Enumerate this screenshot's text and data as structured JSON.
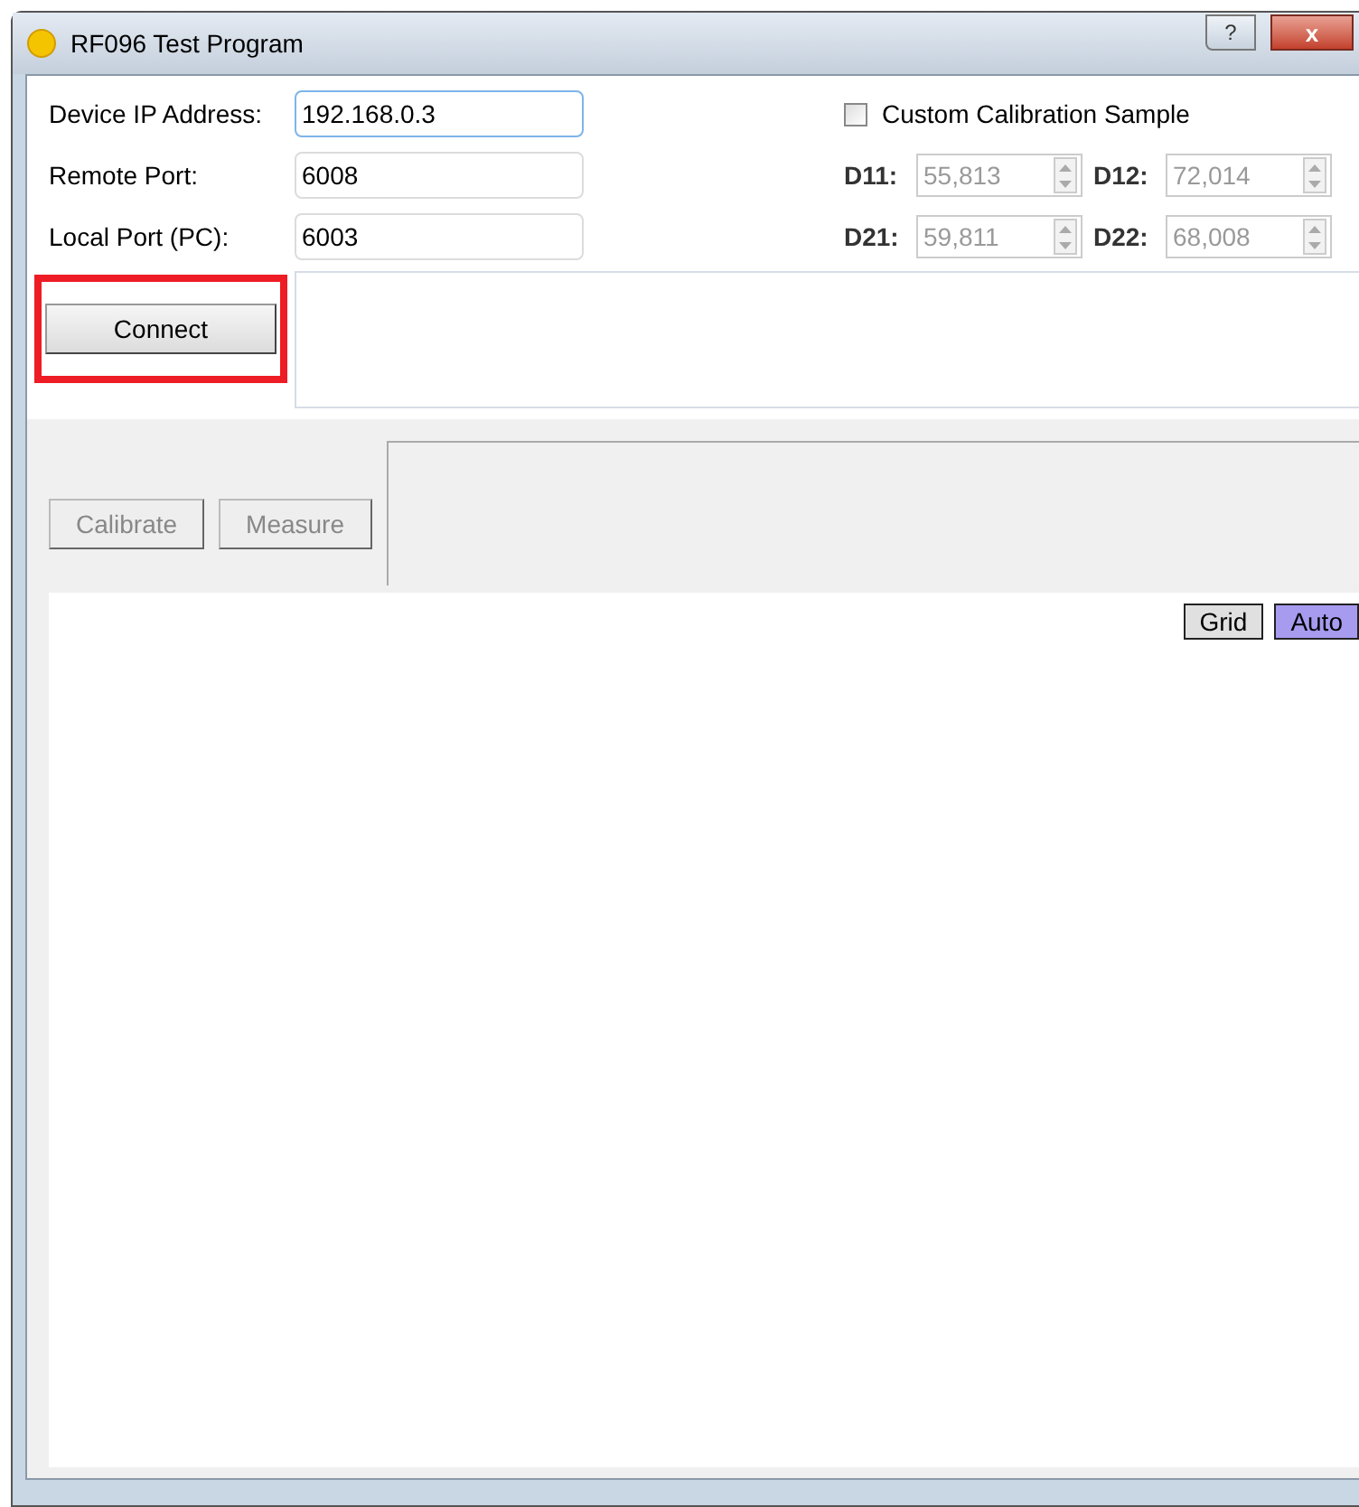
{
  "window": {
    "title": "RF096 Test Program",
    "help_button": "?",
    "close_button": "x"
  },
  "connection": {
    "fields": [
      {
        "label": "Device IP Address:",
        "value": "192.168.0.3",
        "focused": true
      },
      {
        "label": "Remote Port:",
        "value": "6008",
        "focused": false
      },
      {
        "label": "Local Port (PC):",
        "value": "6003",
        "focused": false
      }
    ],
    "connect_button": {
      "label": "Connect",
      "highlighted": true
    }
  },
  "calibration": {
    "checkbox": {
      "label": "Custom Calibration Sample",
      "checked": false
    },
    "spinboxes": [
      {
        "label": "D11:",
        "value": "55,813",
        "disabled": true
      },
      {
        "label": "D12:",
        "value": "72,014",
        "disabled": true
      },
      {
        "label": "D21:",
        "value": "59,811",
        "disabled": true
      },
      {
        "label": "D22:",
        "value": "68,008",
        "disabled": true
      }
    ]
  },
  "actions": [
    {
      "label": "Calibrate",
      "disabled": true
    },
    {
      "label": "Measure",
      "disabled": true
    }
  ],
  "plot": {
    "toggles": [
      {
        "label": "Grid",
        "selected": false
      },
      {
        "label": "Auto",
        "selected": true
      }
    ]
  }
}
